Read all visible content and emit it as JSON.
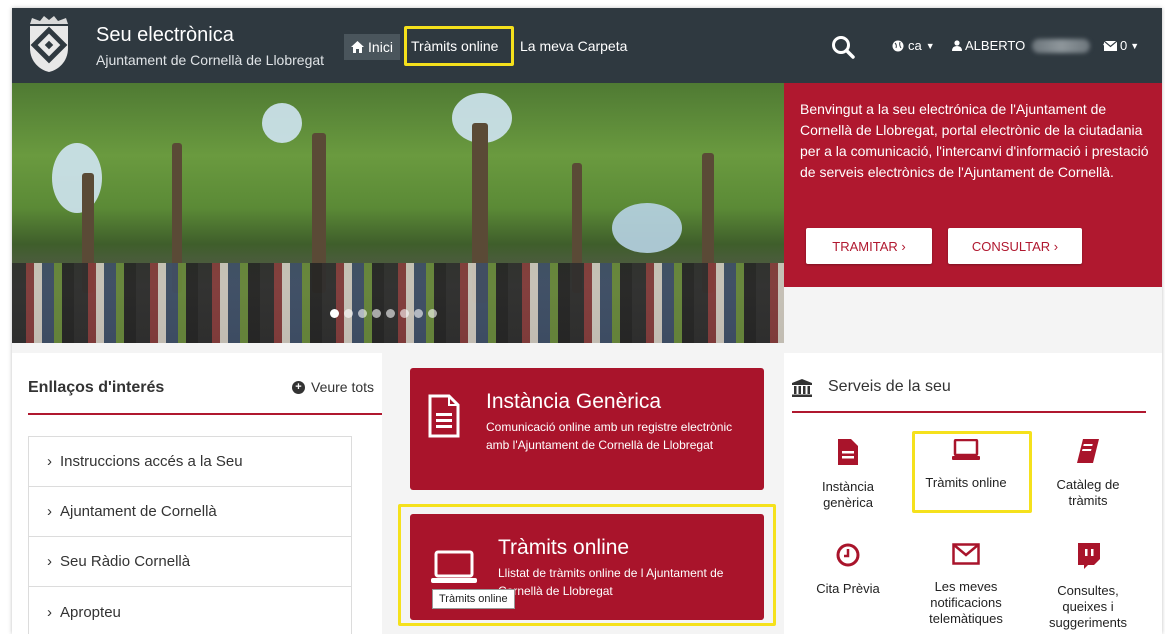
{
  "header": {
    "title": "Seu electrònica",
    "subtitle": "Ajuntament de Cornellà de Llobregat",
    "nav": {
      "home": "Inici",
      "online": "Tràmits online",
      "folder": "La meva Carpeta"
    },
    "lang": "ca",
    "user": "ALBERTO",
    "mail_count": "0"
  },
  "hero": {
    "welcome": "Benvingut a la seu electrónica de l'Ajuntament de Cornellà de Llobregat, portal electrònic de la ciutadania per a la comunicació, l'intercanvi d'informació i prestació de serveis electrònics de l'Ajuntament de Cornellà.",
    "btn_tramitar": "TRAMITAR ›",
    "btn_consultar": "CONSULTAR ›"
  },
  "links": {
    "title": "Enllaços d'interés",
    "see_all": "Veure tots",
    "items": [
      "Instruccions accés a la Seu",
      "Ajuntament de Cornellà",
      "Seu Ràdio Cornellà",
      "Apropteu"
    ]
  },
  "cards": [
    {
      "title": "Instància Genèrica",
      "desc": "Comunicació online amb un registre electrònic amb l'Ajuntament de Cornellà de Llobregat"
    },
    {
      "title": "Tràmits online",
      "desc": "Llistat de tràmits online de l Ajuntament de Cornellà de Llobregat"
    }
  ],
  "tooltip": "Tràmits online",
  "services": {
    "title": "Serveis de la seu",
    "items": [
      "Instància genèrica",
      "Tràmits online",
      "Catàleg de tràmits",
      "Cita Prèvia",
      "Les meves notificacions telemàtiques",
      "Consultes, queixes i suggeriments"
    ]
  },
  "colors": {
    "brand": "#a9142b",
    "navbar": "#2f3940",
    "highlight": "#f5e11c"
  }
}
